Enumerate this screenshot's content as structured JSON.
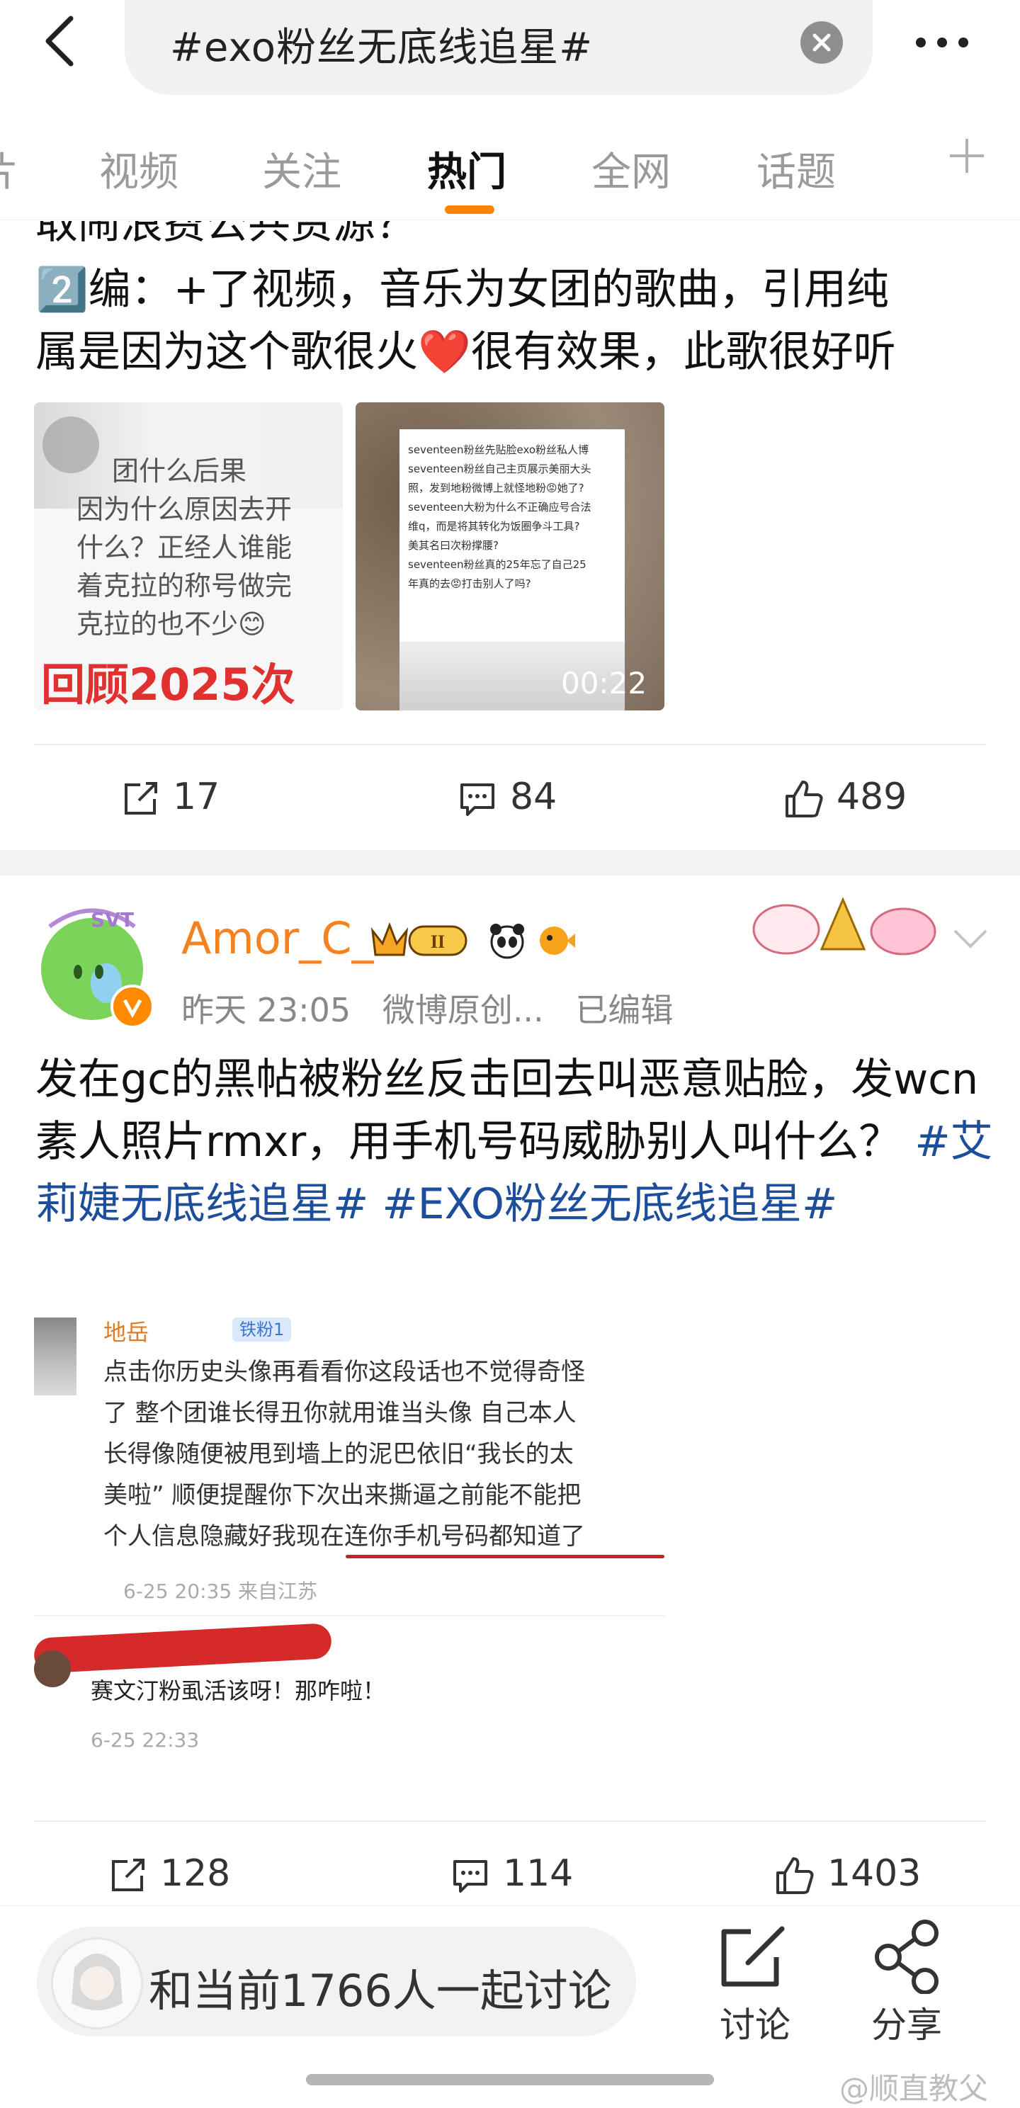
{
  "search": {
    "query": "#exo粉丝无底线追星#"
  },
  "tabs": [
    {
      "label": "片",
      "active": false
    },
    {
      "label": "视频",
      "active": false
    },
    {
      "label": "关注",
      "active": false
    },
    {
      "label": "热门",
      "active": true
    },
    {
      "label": "全网",
      "active": false
    },
    {
      "label": "话题",
      "active": false
    }
  ],
  "post1": {
    "text_lines": [
      "取闹浪费公共资源？",
      "2️⃣编：+了视频，音乐为女团的歌曲，引用纯",
      "属是因为这个歌很火❤️很有效果，此歌很好听"
    ],
    "image1_text": [
      "团什么后果",
      "因为什么原因去开",
      "什么？正经人谁能",
      "着克拉的称号做完",
      "克拉的也不少😊",
      "回顾2025次"
    ],
    "video": {
      "duration": "00:22",
      "caption_lines": [
        "seventeen粉丝先贴脸exo粉丝私人博",
        "seventeen粉丝自己主页展示美丽大头",
        "照，发到地粉微博上就怪地粉😡她了?",
        "seventeen大粉为什么不正确应号合法",
        "维q，而是将其转化为饭圈争斗工具?",
        "美其名曰次粉撑腰?",
        "seventeen粉丝真的25年忘了自己25",
        "年真的去😡打击别人了吗?"
      ]
    },
    "reposts": "17",
    "comments": "84",
    "likes": "489"
  },
  "post2": {
    "username": "Amor_C_",
    "avatar_label": "SVT",
    "time": "昨天 23:05",
    "source": "微博原创...",
    "edited": "已编辑",
    "badge_level": "II",
    "text_parts": [
      {
        "t": "发在gc的黑帖被粉丝反击回去叫恶意贴脸，发wcn素人照片rmxr，用手机号码威胁别人叫什么？ ",
        "topic": false
      },
      {
        "t": "#艾莉婕无底线追星#",
        "topic": true
      },
      {
        "t": " ",
        "topic": false
      },
      {
        "t": "#EXO粉丝无底线追星#",
        "topic": true
      }
    ],
    "screenshot": {
      "comment1_user": "地岳",
      "comment1_badge": "铁粉1",
      "comment1_lines": [
        "点击你历史头像再看看你这段话也不觉得奇怪",
        "了 整个团谁长得丑你就用谁当头像 自己本人",
        "长得像随便被甩到墙上的泥巴依旧“我长的太",
        "美啦” 顺便提醒你下次出来撕逼之前能不能把",
        "个人信息隐藏好我现在连你手机号码都知道了"
      ],
      "comment1_meta": "6-25 20:35 来自江苏",
      "comment2_text": "赛文汀粉虱活该呀！那咋啦！",
      "comment2_meta": "6-25 22:33"
    },
    "reposts": "128",
    "comments": "114",
    "likes": "1403"
  },
  "bottom": {
    "discuss_text": "和当前1766人一起讨论",
    "discuss_button": "讨论",
    "share_button": "分享"
  },
  "watermark": "@顺直教父",
  "colors": {
    "accent": "#ff8200",
    "topic": "#1d4e9b",
    "username": "#f58220"
  }
}
